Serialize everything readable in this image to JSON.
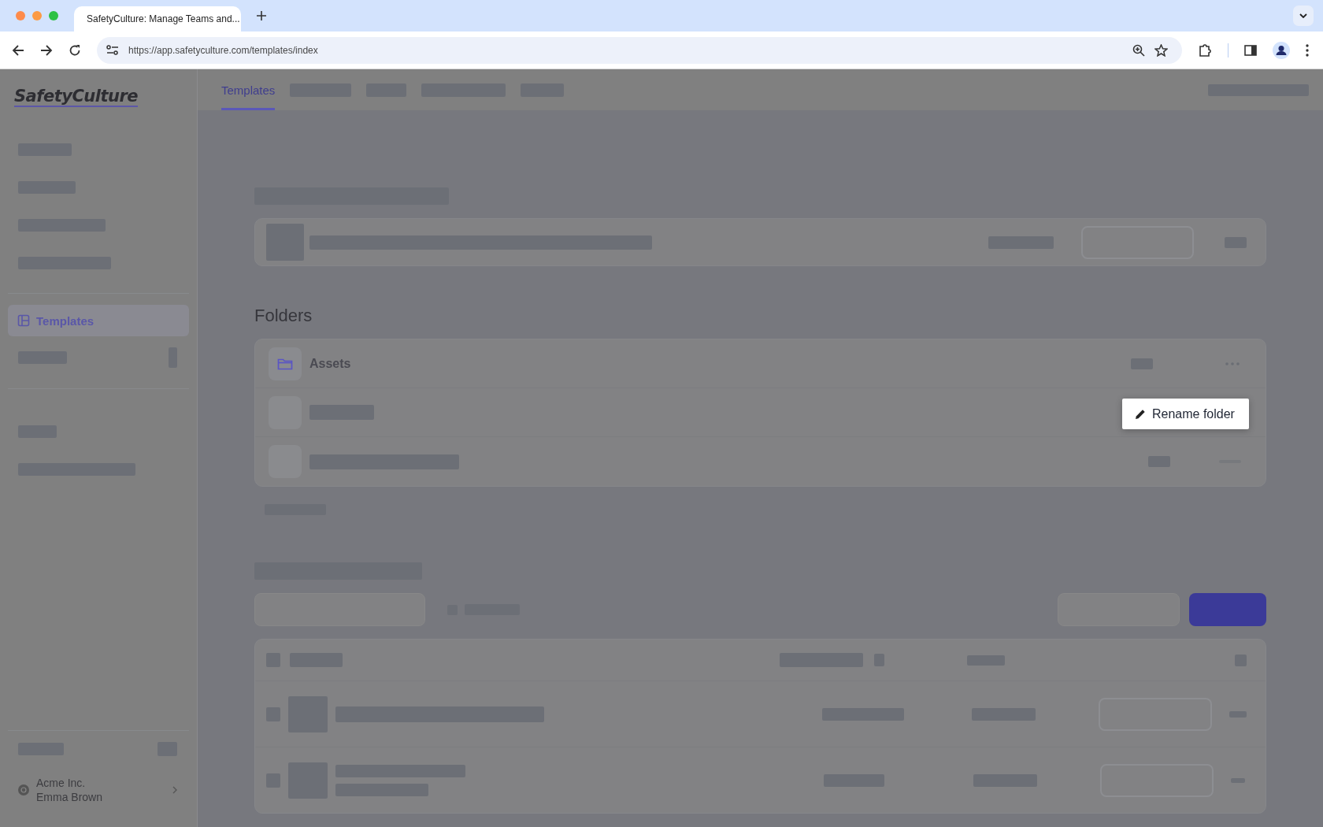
{
  "browser": {
    "tab_title": "SafetyCulture: Manage Teams and...",
    "url": "https://app.safetyculture.com/templates/index"
  },
  "sidebar": {
    "logo": "SafetyCulture",
    "items": [
      {
        "label": "Templates",
        "selected": true
      }
    ],
    "account": {
      "org": "Acme Inc.",
      "user": "Emma Brown"
    }
  },
  "tabs": [
    {
      "label": "Templates",
      "selected": true
    }
  ],
  "folders": {
    "heading": "Folders",
    "items": [
      {
        "name": "Assets"
      }
    ]
  },
  "menu": {
    "items": [
      {
        "label": "Rename folder"
      }
    ]
  }
}
